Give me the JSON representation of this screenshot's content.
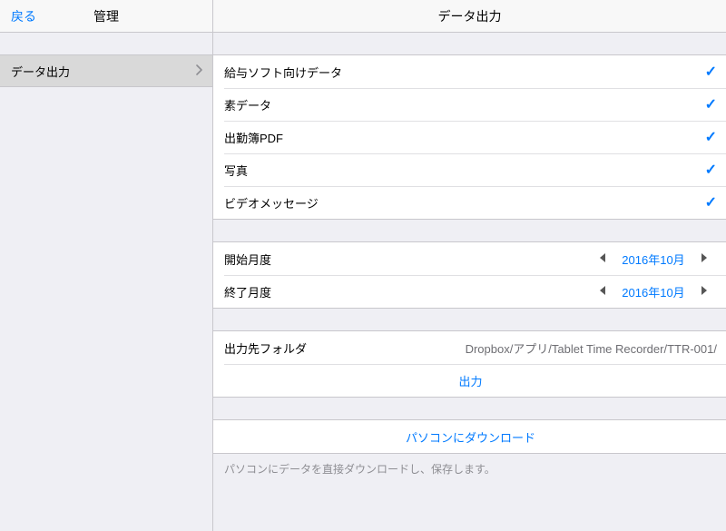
{
  "nav": {
    "back": "戻る",
    "left_title": "管理",
    "right_title": "データ出力"
  },
  "sidebar": {
    "items": [
      {
        "label": "データ出力"
      }
    ]
  },
  "export_options": [
    {
      "label": "給与ソフト向けデータ"
    },
    {
      "label": "素データ"
    },
    {
      "label": "出勤簿PDF"
    },
    {
      "label": "写真"
    },
    {
      "label": "ビデオメッセージ"
    }
  ],
  "period": {
    "start_label": "開始月度",
    "start_value": "2016年10月",
    "end_label": "終了月度",
    "end_value": "2016年10月"
  },
  "output": {
    "folder_label": "出力先フォルダ",
    "folder_value": "Dropbox/アプリ/Tablet Time Recorder/TTR-001/",
    "export_button": "出力"
  },
  "download": {
    "button": "パソコンにダウンロード",
    "footer": "パソコンにデータを直接ダウンロードし、保存します。"
  }
}
